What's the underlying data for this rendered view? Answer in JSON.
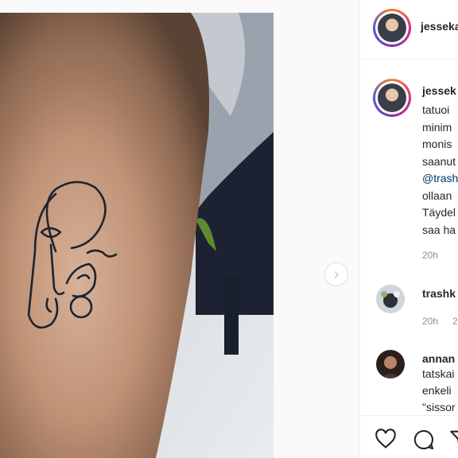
{
  "post": {
    "author": "jesseka",
    "carousel_next_icon": "chevron-right-icon"
  },
  "caption": {
    "username": "jessek",
    "lines": [
      "tatuoi",
      "minim",
      "monis",
      "saanut",
      "@trash",
      "ollaan",
      "Täydel",
      "saa ha"
    ],
    "mention_index": 4,
    "time": "20h"
  },
  "comments": [
    {
      "username": "trashk",
      "time": "20h",
      "meta": "2"
    },
    {
      "username": "annan",
      "lines": [
        "tatskai",
        "enkeli",
        "\"sissor"
      ]
    }
  ],
  "actions": {
    "like_icon": "heart-icon",
    "comment_icon": "comment-icon",
    "share_icon": "share-icon"
  },
  "colors": {
    "mention": "#00376b",
    "muted": "#8e8e8e",
    "story_ring": "#dd2a7b"
  }
}
